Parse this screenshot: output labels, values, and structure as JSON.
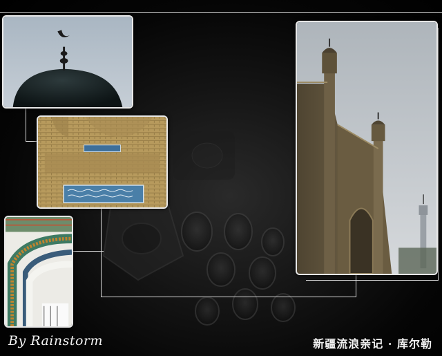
{
  "signature": "By Rainstorm",
  "caption": "新疆流浪亲记 · 库尔勒",
  "photos": [
    {
      "name": "dome-crescent-photo"
    },
    {
      "name": "inscription-wall-photo"
    },
    {
      "name": "arch-detail-photo"
    },
    {
      "name": "mosque-minarets-photo"
    }
  ]
}
